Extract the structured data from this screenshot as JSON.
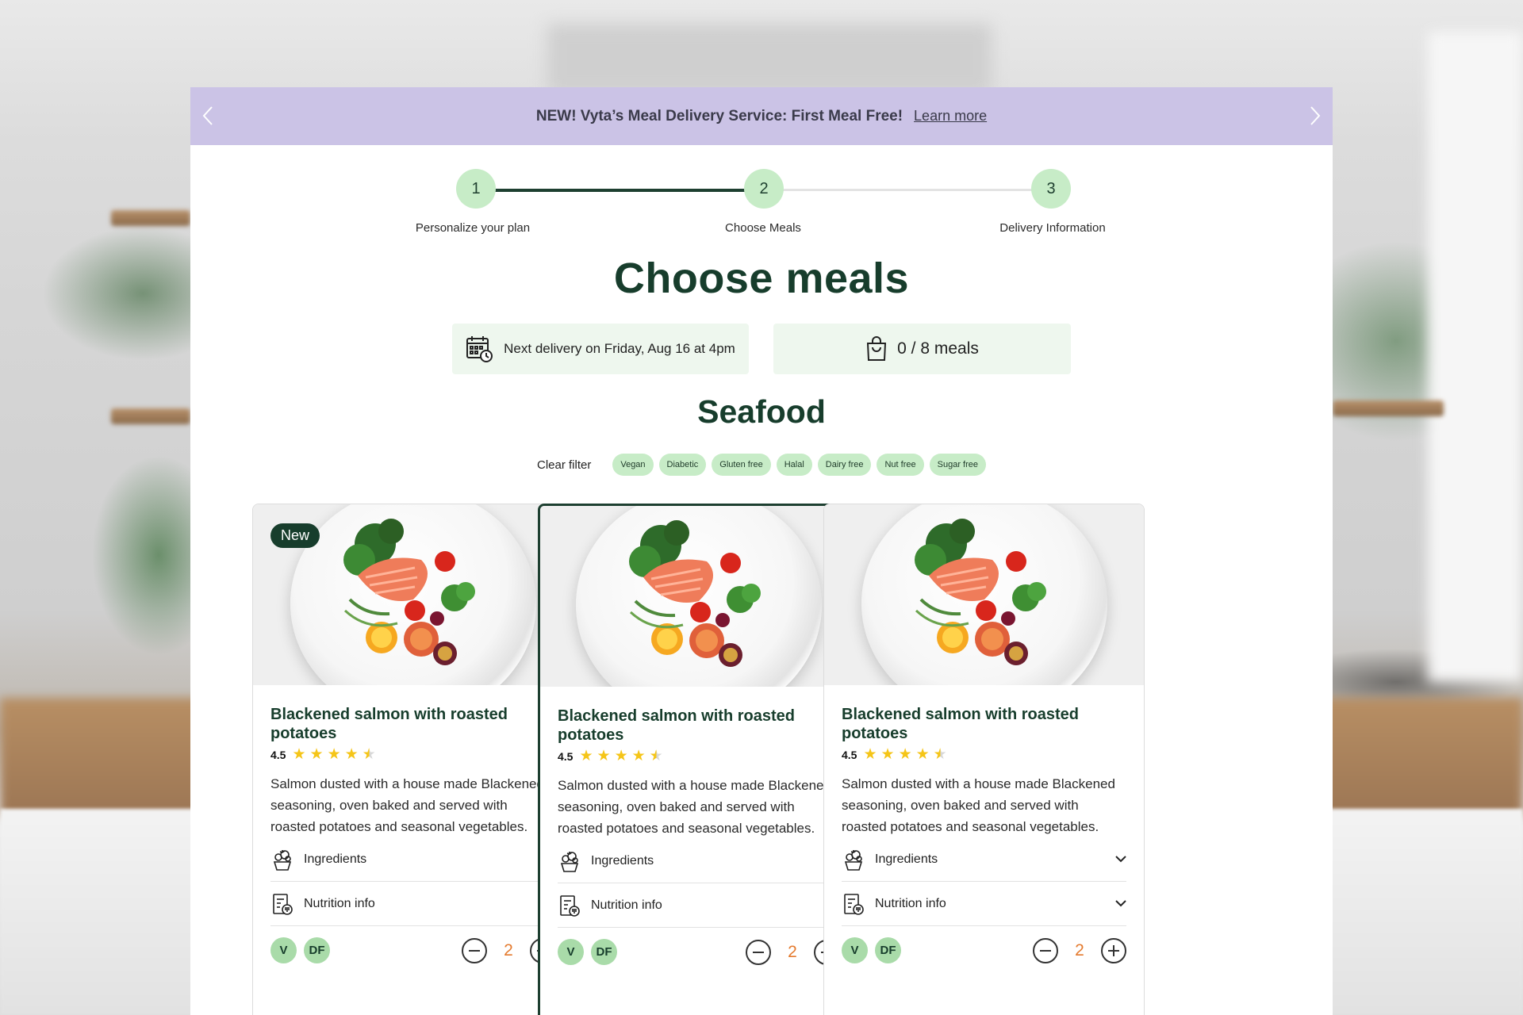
{
  "banner": {
    "text": "NEW! Vyta’s Meal Delivery Service: First Meal Free!",
    "link": "Learn more"
  },
  "steps": [
    {
      "number": "1",
      "label": "Personalize your plan"
    },
    {
      "number": "2",
      "label": "Choose Meals"
    },
    {
      "number": "3",
      "label": "Delivery Information"
    }
  ],
  "page_title": "Choose meals",
  "delivery": {
    "text": "Next delivery on Friday, Aug 16 at 4pm"
  },
  "cart": {
    "text": "0 / 8 meals"
  },
  "section_title": "Seafood",
  "filters": {
    "clear": "Clear filter",
    "chips": [
      "Vegan",
      "Diabetic",
      "Gluten free",
      "Halal",
      "Dairy free",
      "Nut free",
      "Sugar free"
    ]
  },
  "meals": [
    {
      "badge": "New",
      "title": "Blackened salmon with roasted potatoes",
      "rating": "4.5",
      "stars": 4.5,
      "description": "Salmon dusted with a house made Blackened seasoning, oven baked and served with roasted potatoes and seasonal vegetables.",
      "ingredients_label": "Ingredients",
      "nutrition_label": "Nutrition info",
      "tags": [
        "V",
        "DF"
      ],
      "quantity": "2"
    },
    {
      "badge": "",
      "title": "Blackened salmon with roasted potatoes",
      "rating": "4.5",
      "stars": 4.5,
      "description": "Salmon dusted with a house made Blackened seasoning, oven baked and served with roasted potatoes and seasonal vegetables.",
      "ingredients_label": "Ingredients",
      "nutrition_label": "Nutrition info",
      "tags": [
        "V",
        "DF"
      ],
      "quantity": "2"
    },
    {
      "badge": "",
      "title": "Blackened salmon with roasted potatoes",
      "rating": "4.5",
      "stars": 4.5,
      "description": "Salmon dusted with a house made Blackened seasoning, oven baked and served with roasted potatoes and seasonal vegetables.",
      "ingredients_label": "Ingredients",
      "nutrition_label": "Nutrition info",
      "tags": [
        "V",
        "DF"
      ],
      "quantity": "2"
    }
  ],
  "colors": {
    "banner_bg": "#cbc3e6",
    "brand_dark_green": "#173d2c",
    "chip_green": "#c7ecc7",
    "quantity_orange": "#e47a2e",
    "star_yellow": "#f5c518"
  }
}
